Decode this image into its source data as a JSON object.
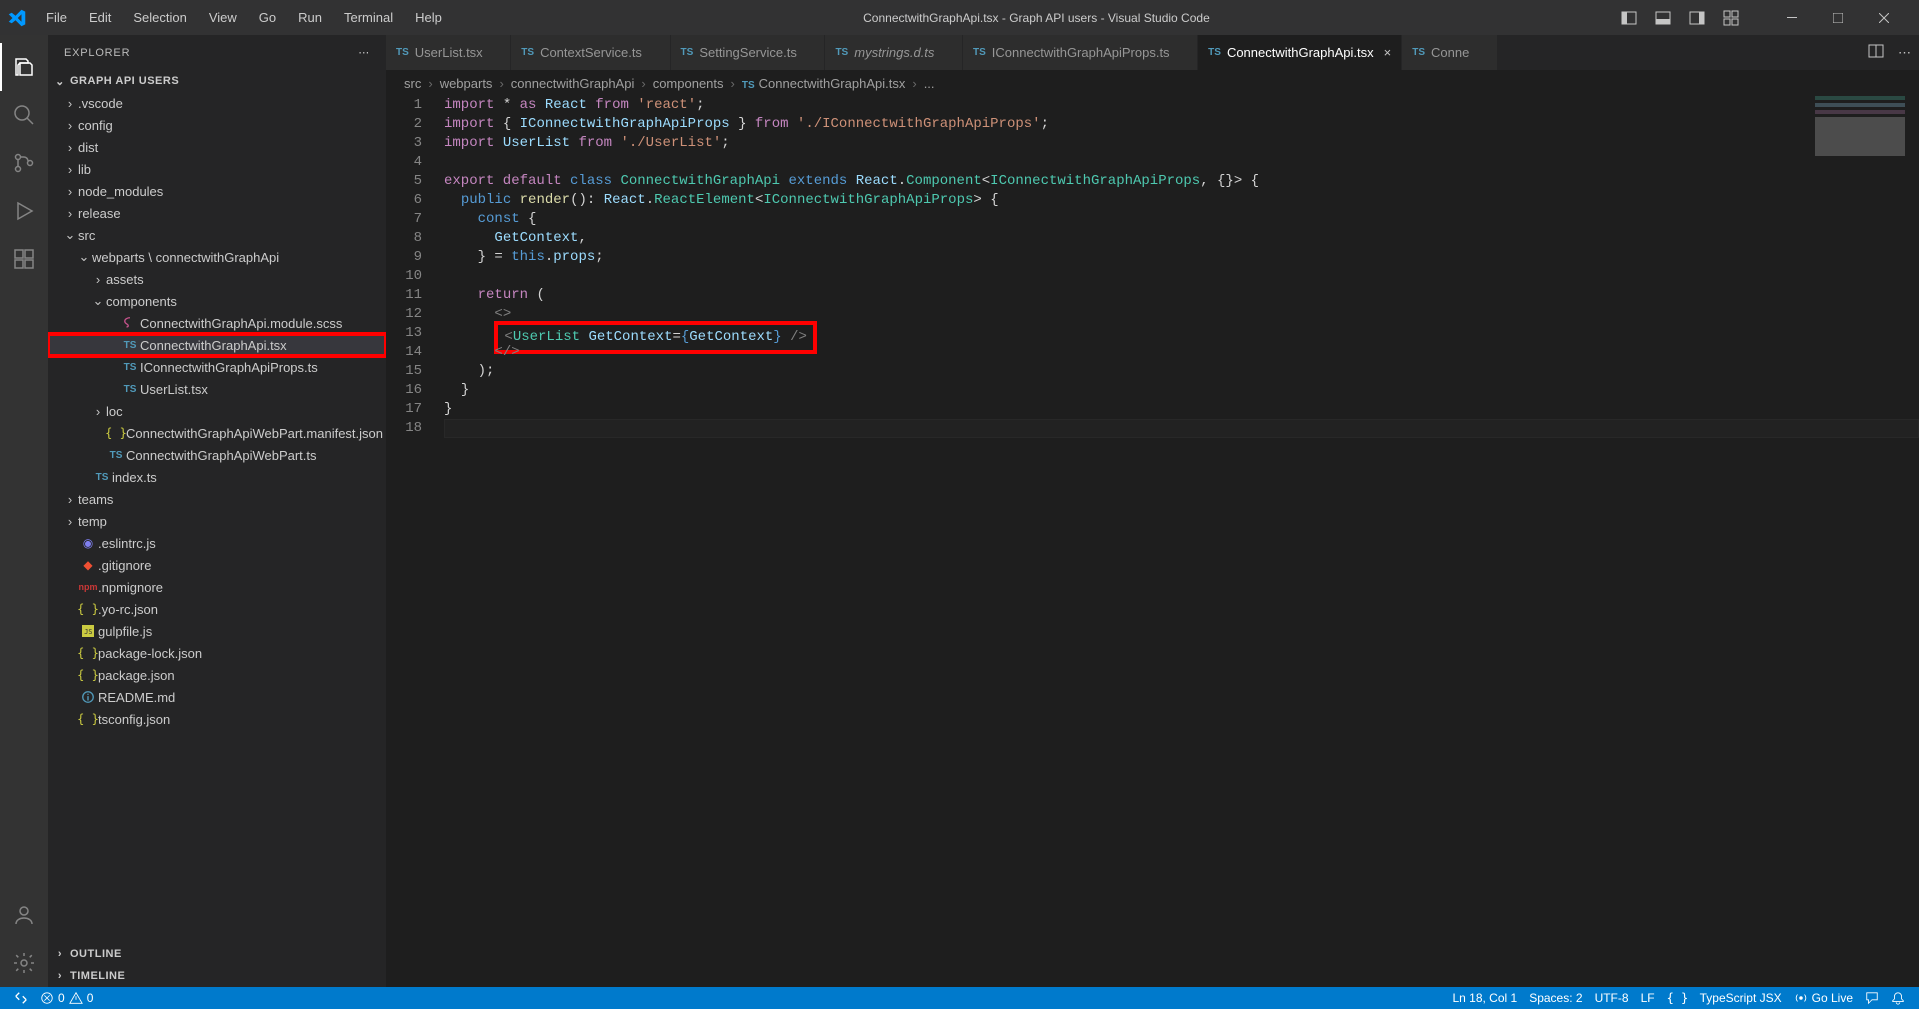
{
  "titlebar": {
    "title": "ConnectwithGraphApi.tsx - Graph API users - Visual Studio Code",
    "menu": [
      "File",
      "Edit",
      "Selection",
      "View",
      "Go",
      "Run",
      "Terminal",
      "Help"
    ]
  },
  "activity": {
    "items": [
      "explorer",
      "search",
      "source-control",
      "run-debug",
      "extensions"
    ],
    "bottom": [
      "accounts",
      "settings"
    ]
  },
  "explorer": {
    "title": "EXPLORER",
    "project": "GRAPH API USERS",
    "outline": "OUTLINE",
    "timeline": "TIMELINE",
    "tree": [
      {
        "type": "folder",
        "name": ".vscode",
        "depth": 0,
        "expanded": false
      },
      {
        "type": "folder",
        "name": "config",
        "depth": 0,
        "expanded": false
      },
      {
        "type": "folder",
        "name": "dist",
        "depth": 0,
        "expanded": false
      },
      {
        "type": "folder",
        "name": "lib",
        "depth": 0,
        "expanded": false
      },
      {
        "type": "folder",
        "name": "node_modules",
        "depth": 0,
        "expanded": false
      },
      {
        "type": "folder",
        "name": "release",
        "depth": 0,
        "expanded": false
      },
      {
        "type": "folder",
        "name": "src",
        "depth": 0,
        "expanded": true
      },
      {
        "type": "folder",
        "name": "webparts \\ connectwithGraphApi",
        "depth": 1,
        "expanded": true
      },
      {
        "type": "folder",
        "name": "assets",
        "depth": 2,
        "expanded": false
      },
      {
        "type": "folder",
        "name": "components",
        "depth": 2,
        "expanded": true
      },
      {
        "type": "file",
        "name": "ConnectwithGraphApi.module.scss",
        "depth": 3,
        "icon": "scss"
      },
      {
        "type": "file",
        "name": "ConnectwithGraphApi.tsx",
        "depth": 3,
        "icon": "ts",
        "selected": true,
        "highlight": true
      },
      {
        "type": "file",
        "name": "IConnectwithGraphApiProps.ts",
        "depth": 3,
        "icon": "ts"
      },
      {
        "type": "file",
        "name": "UserList.tsx",
        "depth": 3,
        "icon": "ts"
      },
      {
        "type": "folder",
        "name": "loc",
        "depth": 2,
        "expanded": false
      },
      {
        "type": "file",
        "name": "ConnectwithGraphApiWebPart.manifest.json",
        "depth": 2,
        "icon": "json"
      },
      {
        "type": "file",
        "name": "ConnectwithGraphApiWebPart.ts",
        "depth": 2,
        "icon": "ts"
      },
      {
        "type": "file",
        "name": "index.ts",
        "depth": 1,
        "icon": "ts"
      },
      {
        "type": "folder",
        "name": "teams",
        "depth": 0,
        "expanded": false
      },
      {
        "type": "folder",
        "name": "temp",
        "depth": 0,
        "expanded": false
      },
      {
        "type": "file",
        "name": ".eslintrc.js",
        "depth": 0,
        "icon": "eslint"
      },
      {
        "type": "file",
        "name": ".gitignore",
        "depth": 0,
        "icon": "git"
      },
      {
        "type": "file",
        "name": ".npmignore",
        "depth": 0,
        "icon": "npm"
      },
      {
        "type": "file",
        "name": ".yo-rc.json",
        "depth": 0,
        "icon": "json"
      },
      {
        "type": "file",
        "name": "gulpfile.js",
        "depth": 0,
        "icon": "js"
      },
      {
        "type": "file",
        "name": "package-lock.json",
        "depth": 0,
        "icon": "json"
      },
      {
        "type": "file",
        "name": "package.json",
        "depth": 0,
        "icon": "json"
      },
      {
        "type": "file",
        "name": "README.md",
        "depth": 0,
        "icon": "md"
      },
      {
        "type": "file",
        "name": "tsconfig.json",
        "depth": 0,
        "icon": "json"
      }
    ]
  },
  "tabs": [
    {
      "label": "UserList.tsx",
      "active": false
    },
    {
      "label": "ContextService.ts",
      "active": false
    },
    {
      "label": "SettingService.ts",
      "active": false
    },
    {
      "label": "mystrings.d.ts",
      "active": false,
      "italic": true
    },
    {
      "label": "IConnectwithGraphApiProps.ts",
      "active": false
    },
    {
      "label": "ConnectwithGraphApi.tsx",
      "active": true
    },
    {
      "label": "Conne",
      "active": false,
      "truncated": true
    }
  ],
  "breadcrumb": [
    "src",
    "webparts",
    "connectwithGraphApi",
    "components",
    "ConnectwithGraphApi.tsx",
    "..."
  ],
  "code": {
    "lines": 18
  },
  "statusbar": {
    "errors": "0",
    "warnings": "0",
    "lncol": "Ln 18, Col 1",
    "spaces": "Spaces: 2",
    "encoding": "UTF-8",
    "eol": "LF",
    "lang": "TypeScript JSX",
    "golive": "Go Live"
  }
}
